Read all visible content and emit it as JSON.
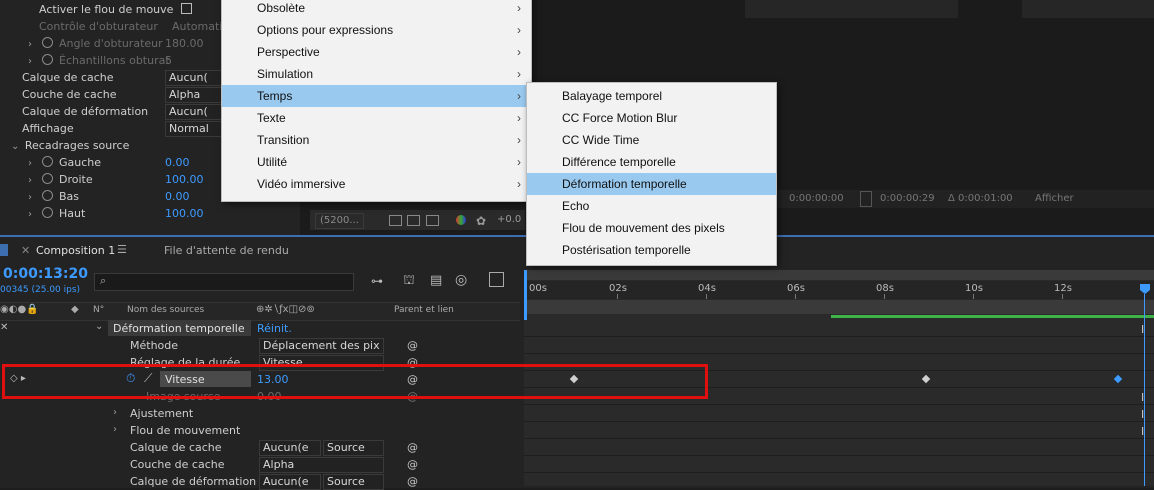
{
  "effect_controls": {
    "motion_blur_label": "Activer le flou de mouve",
    "shutter_control_label": "Contrôle d'obturateur",
    "shutter_control_value": "Automatic",
    "shutter_angle_label": "Angle d'obturateur",
    "shutter_angle_value": "180.00",
    "shutter_samples_label": "Échantillons obturat",
    "shutter_samples_value": "5",
    "matte_layer_label": "Calque de cache",
    "matte_layer_value": "Aucun(",
    "matte_channel_label": "Couche de cache",
    "matte_channel_value": "Alpha",
    "warp_layer_label": "Calque de déformation",
    "warp_layer_value": "Aucun(",
    "display_label": "Affichage",
    "display_value": "Normal",
    "source_crops_label": "Recadrages source",
    "left_label": "Gauche",
    "left_value": "0.00",
    "right_label": "Droite",
    "right_value": "100.00",
    "bottom_label": "Bas",
    "bottom_value": "0.00",
    "top_label": "Haut",
    "top_value": "100.00"
  },
  "viewer_bar": {
    "zoom": "(5200...",
    "exposure": "+0.0",
    "tc_start": "0:00:00:00",
    "tc_end": "0:00:00:29",
    "duration": "Δ 0:00:01:00",
    "display_label": "Afficher"
  },
  "main_menu": {
    "items": [
      {
        "label": "Obsolète"
      },
      {
        "label": "Options pour expressions"
      },
      {
        "label": "Perspective"
      },
      {
        "label": "Simulation"
      },
      {
        "label": "Temps"
      },
      {
        "label": "Texte"
      },
      {
        "label": "Transition"
      },
      {
        "label": "Utilité"
      },
      {
        "label": "Vidéo immersive"
      }
    ]
  },
  "sub_menu": {
    "items": [
      {
        "label": "Balayage temporel"
      },
      {
        "label": "CC Force Motion Blur"
      },
      {
        "label": "CC Wide Time"
      },
      {
        "label": "Différence temporelle"
      },
      {
        "label": "Déformation temporelle"
      },
      {
        "label": "Echo"
      },
      {
        "label": "Flou de mouvement des pixels"
      },
      {
        "label": "Postérisation temporelle"
      }
    ]
  },
  "timeline": {
    "tab_label": "Composition 1",
    "render_queue_label": "File d'attente de rendu",
    "timecode": "0:00:13:20",
    "frame_info": "00345 (25.00 ips)",
    "search_placeholder": "",
    "col_number": "N°",
    "col_source": "Nom des sources",
    "col_parent": "Parent et lien",
    "ruler_labels": [
      "00s",
      "02s",
      "04s",
      "06s",
      "08s",
      "10s",
      "12s"
    ],
    "layers": {
      "effect_name": "Déformation temporelle",
      "reset_label": "Réinit.",
      "method_label": "Méthode",
      "method_value": "Déplacement des pix",
      "duration_label": "Réglage de la durée",
      "duration_value": "Vitesse",
      "speed_label": "Vitesse",
      "speed_value": "13.00",
      "source_frame_label": "Image source",
      "source_frame_value": "0.00",
      "adjust_label": "Ajustement",
      "motion_blur_label": "Flou de mouvement",
      "matte_layer_label": "Calque de cache",
      "matte_layer_value": "Aucun(e",
      "matte_layer_value2": "Source",
      "matte_channel_label": "Couche de cache",
      "matte_channel_value": "Alpha",
      "warp_layer_label": "Calque de déformation",
      "warp_layer_value": "Aucun(e",
      "warp_layer_value2": "Source"
    }
  },
  "colors": {
    "menu_highlight": "#99c9ef",
    "accent_blue": "#3d9bff",
    "annotation_red": "#e01010",
    "work_area_green": "#3fb24a"
  }
}
